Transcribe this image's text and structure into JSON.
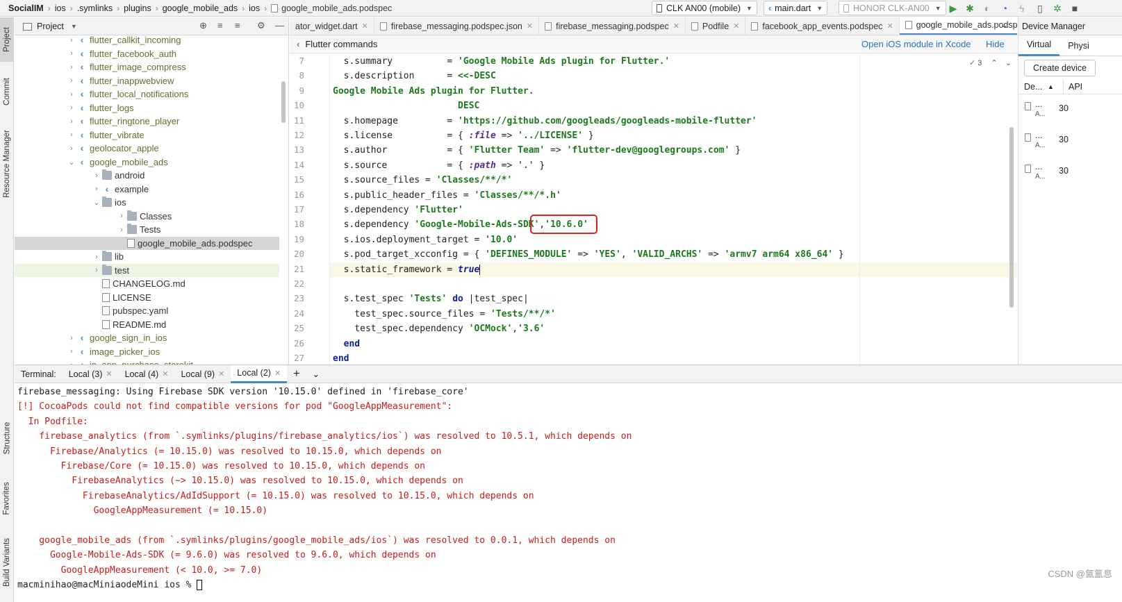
{
  "breadcrumb": [
    "SocialIM",
    "ios",
    ".symlinks",
    "plugins",
    "google_mobile_ads",
    "ios"
  ],
  "breadcrumb_file": "google_mobile_ads.podspec",
  "toolbar": {
    "device_selector": "CLK AN00 (mobile)",
    "config_selector": "main.dart",
    "target_selector": "HONOR CLK-AN00"
  },
  "left_strip": [
    "Project",
    "Commit",
    "Resource Manager",
    "Structure",
    "Favorites",
    "Build Variants"
  ],
  "project_panel": {
    "title": "Project",
    "tree": [
      {
        "label": "flutter_callkit_incoming",
        "icon": "flutter",
        "arrow": "›",
        "indent": 0
      },
      {
        "label": "flutter_facebook_auth",
        "icon": "flutter",
        "arrow": "›",
        "indent": 0
      },
      {
        "label": "flutter_image_compress",
        "icon": "flutter",
        "arrow": "›",
        "indent": 0
      },
      {
        "label": "flutter_inappwebview",
        "icon": "flutter",
        "arrow": "›",
        "indent": 0
      },
      {
        "label": "flutter_local_notifications",
        "icon": "flutter",
        "arrow": "›",
        "indent": 0
      },
      {
        "label": "flutter_logs",
        "icon": "flutter",
        "arrow": "›",
        "indent": 0
      },
      {
        "label": "flutter_ringtone_player",
        "icon": "flutter",
        "arrow": "›",
        "indent": 0
      },
      {
        "label": "flutter_vibrate",
        "icon": "flutter",
        "arrow": "›",
        "indent": 0
      },
      {
        "label": "geolocator_apple",
        "icon": "flutter",
        "arrow": "›",
        "indent": 0
      },
      {
        "label": "google_mobile_ads",
        "icon": "flutter",
        "arrow": "⌄",
        "indent": 0
      },
      {
        "label": "android",
        "icon": "folder",
        "arrow": "›",
        "indent": 1
      },
      {
        "label": "example",
        "icon": "flutter",
        "arrow": "›",
        "indent": 1
      },
      {
        "label": "ios",
        "icon": "folder",
        "arrow": "⌄",
        "indent": 1
      },
      {
        "label": "Classes",
        "icon": "folder",
        "arrow": "›",
        "indent": 2
      },
      {
        "label": "Tests",
        "icon": "folder",
        "arrow": "›",
        "indent": 2
      },
      {
        "label": "google_mobile_ads.podspec",
        "icon": "file",
        "arrow": "",
        "indent": 2,
        "selected": true
      },
      {
        "label": "lib",
        "icon": "folder",
        "arrow": "›",
        "indent": 1
      },
      {
        "label": "test",
        "icon": "folder",
        "arrow": "›",
        "indent": 1,
        "green": true
      },
      {
        "label": "CHANGELOG.md",
        "icon": "file",
        "arrow": "",
        "indent": 1
      },
      {
        "label": "LICENSE",
        "icon": "file",
        "arrow": "",
        "indent": 1
      },
      {
        "label": "pubspec.yaml",
        "icon": "file",
        "arrow": "",
        "indent": 1
      },
      {
        "label": "README.md",
        "icon": "file",
        "arrow": "",
        "indent": 1
      },
      {
        "label": "google_sign_in_ios",
        "icon": "flutter",
        "arrow": "›",
        "indent": 0
      },
      {
        "label": "image_picker_ios",
        "icon": "flutter",
        "arrow": "›",
        "indent": 0
      },
      {
        "label": "in_app_purchase_storekit",
        "icon": "flutter",
        "arrow": "›",
        "indent": 0
      }
    ]
  },
  "editor_tabs": [
    {
      "label": "ator_widget.dart",
      "active": false
    },
    {
      "label": "firebase_messaging.podspec.json",
      "active": false
    },
    {
      "label": "firebase_messaging.podspec",
      "active": false
    },
    {
      "label": "Podfile",
      "active": false
    },
    {
      "label": "facebook_app_events.podspec",
      "active": false
    },
    {
      "label": "google_mobile_ads.podspec",
      "active": true
    }
  ],
  "notice_bar": {
    "message": "Flutter commands",
    "open_link": "Open iOS module in Xcode",
    "hide_link": "Hide"
  },
  "inspection": {
    "count": "3"
  },
  "code_lines": [
    {
      "n": "7",
      "html": "  s.summary          = <span class='s'>'Google Mobile Ads plugin for Flutter.'</span>"
    },
    {
      "n": "8",
      "html": "  s.description      = <span class='s'>&lt;&lt;-DESC</span>"
    },
    {
      "n": "9",
      "html": "<span class='s'>Google Mobile Ads plugin for Flutter.</span>"
    },
    {
      "n": "10",
      "html": "<span class='s'>                       DESC</span>"
    },
    {
      "n": "11",
      "html": "  s.homepage         = <span class='s'>'https://github.com/googleads/googleads-mobile-flutter'</span>"
    },
    {
      "n": "12",
      "html": "  s.license          = { <span class='sym'>:file</span> => <span class='s'>'../LICENSE'</span> }"
    },
    {
      "n": "13",
      "html": "  s.author           = { <span class='s'>'Flutter Team'</span> => <span class='s'>'flutter-dev@googlegroups.com'</span> }"
    },
    {
      "n": "14",
      "html": "  s.source           = { <span class='sym'>:path</span> => <span class='s'>'.'</span> }"
    },
    {
      "n": "15",
      "html": "  s.source_files = <span class='s'>'Classes/**/*'</span>"
    },
    {
      "n": "16",
      "html": "  s.public_header_files = <span class='s'>'Classes/**/*.h'</span>"
    },
    {
      "n": "17",
      "html": "  s.dependency <span class='s'>'Flutter'</span>"
    },
    {
      "n": "18",
      "html": "  s.dependency <span class='s'>'Google-Mobile-Ads-SDK'</span>,<span class='s'>'10.6.0'</span>"
    },
    {
      "n": "19",
      "html": "  s.ios.deployment_target = <span class='s'>'10.0'</span>"
    },
    {
      "n": "20",
      "html": "  s.pod_target_xcconfig = { <span class='s'>'DEFINES_MODULE'</span> => <span class='s'>'YES'</span>, <span class='s'>'VALID_ARCHS'</span> => <span class='s'>'armv7 arm64 x86_64'</span> }"
    },
    {
      "n": "21",
      "html": "  s.static_framework = <span class='k' style='font-style:italic'>true</span><span class='caret-bar'></span>"
    },
    {
      "n": "22",
      "html": ""
    },
    {
      "n": "23",
      "html": "  s.test_spec <span class='s'>'Tests'</span> <span class='k'>do</span> |test_spec|"
    },
    {
      "n": "24",
      "html": "    test_spec.source_files = <span class='s'>'Tests/**/*'</span>"
    },
    {
      "n": "25",
      "html": "    test_spec.dependency <span class='s'>'OCMock'</span>,<span class='s'>'3.6'</span>"
    },
    {
      "n": "26",
      "html": "  <span class='k'>end</span>"
    },
    {
      "n": "27",
      "html": "<span class='k'>end</span>"
    }
  ],
  "device_manager": {
    "title": "Device Manager",
    "tabs": [
      "Virtual",
      "Physi"
    ],
    "create_button": "Create device",
    "col_device": "De...",
    "col_api": "API",
    "rows": [
      {
        "name": "...",
        "sub": "A...",
        "api": "30"
      },
      {
        "name": "...",
        "sub": "A...",
        "api": "30"
      },
      {
        "name": "...",
        "sub": "A...",
        "api": "30"
      }
    ]
  },
  "terminal": {
    "label": "Terminal:",
    "tabs": [
      {
        "label": "Local (3)",
        "active": false
      },
      {
        "label": "Local (4)",
        "active": false
      },
      {
        "label": "Local (9)",
        "active": false
      },
      {
        "label": "Local (2)",
        "active": true
      }
    ],
    "lines": [
      {
        "text": "firebase_messaging: Using Firebase SDK version '10.15.0' defined in 'firebase_core'",
        "err": false
      },
      {
        "text": "[!] CocoaPods could not find compatible versions for pod \"GoogleAppMeasurement\":",
        "err": true
      },
      {
        "text": "  In Podfile:",
        "err": true
      },
      {
        "text": "    firebase_analytics (from `.symlinks/plugins/firebase_analytics/ios`) was resolved to 10.5.1, which depends on",
        "err": true
      },
      {
        "text": "      Firebase/Analytics (= 10.15.0) was resolved to 10.15.0, which depends on",
        "err": true
      },
      {
        "text": "        Firebase/Core (= 10.15.0) was resolved to 10.15.0, which depends on",
        "err": true
      },
      {
        "text": "          FirebaseAnalytics (~> 10.15.0) was resolved to 10.15.0, which depends on",
        "err": true
      },
      {
        "text": "            FirebaseAnalytics/AdIdSupport (= 10.15.0) was resolved to 10.15.0, which depends on",
        "err": true
      },
      {
        "text": "              GoogleAppMeasurement (= 10.15.0)",
        "err": true
      },
      {
        "text": "",
        "err": true
      },
      {
        "text": "    google_mobile_ads (from `.symlinks/plugins/google_mobile_ads/ios`) was resolved to 0.0.1, which depends on",
        "err": true
      },
      {
        "text": "      Google-Mobile-Ads-SDK (= 9.6.0) was resolved to 9.6.0, which depends on",
        "err": true
      },
      {
        "text": "        GoogleAppMeasurement (< 10.0, >= 7.0)",
        "err": true
      },
      {
        "text": "macminihao@macMiniaodeMini ios % ",
        "err": false
      }
    ]
  },
  "watermark": "CSDN @氤氲息"
}
